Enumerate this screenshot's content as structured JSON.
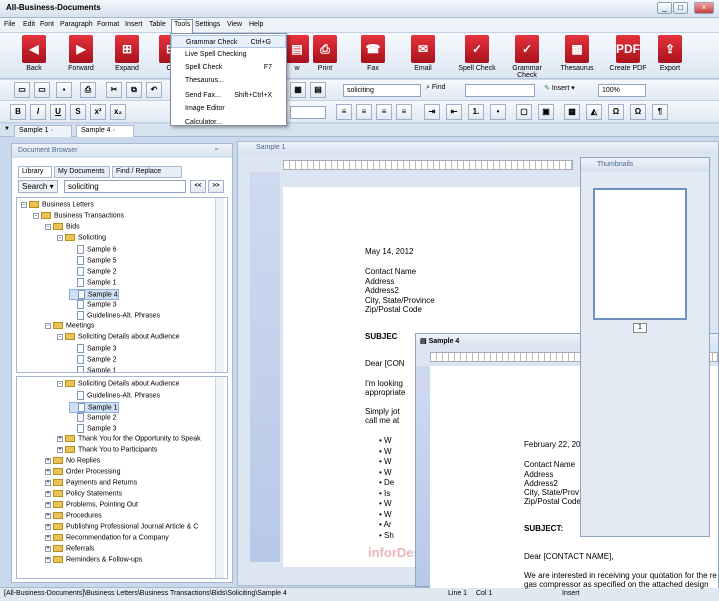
{
  "app": {
    "title": "All-Business-Documents"
  },
  "menu": [
    "File",
    "Edit",
    "Font",
    "Paragraph",
    "Format",
    "Insert",
    "Table",
    "Tools",
    "Settings",
    "View",
    "Help"
  ],
  "ribbon": [
    {
      "label": "Back",
      "icon": "back-arrow-icon",
      "glyph": "◀"
    },
    {
      "label": "Forward",
      "icon": "forward-arrow-icon",
      "glyph": "▶"
    },
    {
      "label": "Expand",
      "icon": "expand-icon",
      "glyph": "⊞"
    },
    {
      "label": "Co",
      "icon": "collapse-icon",
      "glyph": "⊟"
    },
    {
      "label": "w",
      "icon": "preview-icon",
      "glyph": "▤"
    },
    {
      "label": "Print",
      "icon": "print-icon",
      "glyph": "⎙"
    },
    {
      "label": "Fax",
      "icon": "fax-icon",
      "glyph": "☎"
    },
    {
      "label": "Email",
      "icon": "email-icon",
      "glyph": "✉"
    },
    {
      "label": "Spell Check",
      "icon": "spell-check-icon",
      "glyph": "✓"
    },
    {
      "label": "Grammar Check",
      "icon": "grammar-check-icon",
      "glyph": "✓"
    },
    {
      "label": "Thesaurus",
      "icon": "thesaurus-icon",
      "glyph": "▦"
    },
    {
      "label": "Create PDF",
      "icon": "pdf-icon",
      "glyph": "PDF"
    },
    {
      "label": "Export",
      "icon": "export-icon",
      "glyph": "⇪"
    }
  ],
  "tools_menu": [
    {
      "label": "Grammar Check",
      "shortcut": "Ctrl+G"
    },
    {
      "label": "Live Spell Checking",
      "shortcut": ""
    },
    {
      "label": "Spell Check",
      "shortcut": "F7"
    },
    {
      "label": "Thesaurus...",
      "shortcut": ""
    },
    {
      "label": "Send Fax...",
      "shortcut": "Shift+Ctrl+X"
    },
    {
      "label": "Image Editor",
      "shortcut": ""
    },
    {
      "label": "Calculator...",
      "shortcut": ""
    }
  ],
  "toolbar": {
    "search_value": "soliciting",
    "find_label": "Find",
    "insert_label": "Insert",
    "zoom_value": "100%"
  },
  "doc_tabs": [
    "Sample 1",
    "Sample 4"
  ],
  "browser": {
    "title": "Document Browser",
    "tabs": [
      "Library",
      "My Documents",
      "Find / Replace"
    ],
    "search_label": "Search",
    "search_value": "soliciting",
    "prev": "<<",
    "next": ">>",
    "tree_top": [
      {
        "label": "Business Letters",
        "depth": 0,
        "type": "folder",
        "exp": "-"
      },
      {
        "label": "Business Transactions",
        "depth": 1,
        "type": "folder",
        "exp": "-"
      },
      {
        "label": "Bids",
        "depth": 2,
        "type": "folder",
        "exp": "-"
      },
      {
        "label": "Soliciting",
        "depth": 3,
        "type": "folder",
        "exp": "-"
      },
      {
        "label": "Sample 6",
        "depth": 4,
        "type": "doc"
      },
      {
        "label": "Sample 5",
        "depth": 4,
        "type": "doc"
      },
      {
        "label": "Sample 2",
        "depth": 4,
        "type": "doc"
      },
      {
        "label": "Sample 1",
        "depth": 4,
        "type": "doc"
      },
      {
        "label": "Sample 4",
        "depth": 4,
        "type": "doc",
        "sel": true
      },
      {
        "label": "Sample 3",
        "depth": 4,
        "type": "doc"
      },
      {
        "label": "Guidelines-Alt. Phrases",
        "depth": 4,
        "type": "doc"
      },
      {
        "label": "Meetings",
        "depth": 2,
        "type": "folder",
        "exp": "-"
      },
      {
        "label": "Soliciting Details about Audience",
        "depth": 3,
        "type": "folder",
        "exp": "-"
      },
      {
        "label": "Sample 3",
        "depth": 4,
        "type": "doc"
      },
      {
        "label": "Sample 2",
        "depth": 4,
        "type": "doc"
      },
      {
        "label": "Sample 1",
        "depth": 4,
        "type": "doc"
      }
    ],
    "tree_bottom": [
      {
        "label": "Soliciting Details about Audience",
        "depth": 3,
        "type": "folder",
        "exp": "-"
      },
      {
        "label": "Guidelines-Alt. Phrases",
        "depth": 4,
        "type": "doc"
      },
      {
        "label": "Sample 1",
        "depth": 4,
        "type": "doc",
        "sel": true
      },
      {
        "label": "Sample 2",
        "depth": 4,
        "type": "doc"
      },
      {
        "label": "Sample 3",
        "depth": 4,
        "type": "doc"
      },
      {
        "label": "Thank You for the Opportunity to Speak",
        "depth": 3,
        "type": "folder",
        "exp": "+"
      },
      {
        "label": "Thank You to Participants",
        "depth": 3,
        "type": "folder",
        "exp": "+"
      },
      {
        "label": "No Replies",
        "depth": 2,
        "type": "folder",
        "exp": "+"
      },
      {
        "label": "Order Processing",
        "depth": 2,
        "type": "folder",
        "exp": "+"
      },
      {
        "label": "Payments and Returns",
        "depth": 2,
        "type": "folder",
        "exp": "+"
      },
      {
        "label": "Policy Statements",
        "depth": 2,
        "type": "folder",
        "exp": "+"
      },
      {
        "label": "Problems, Pointing Out",
        "depth": 2,
        "type": "folder",
        "exp": "+"
      },
      {
        "label": "Procedures",
        "depth": 2,
        "type": "folder",
        "exp": "+"
      },
      {
        "label": "Publishing Professional Journal Article & C",
        "depth": 2,
        "type": "folder",
        "exp": "+"
      },
      {
        "label": "Recommendation for a Company",
        "depth": 2,
        "type": "folder",
        "exp": "+"
      },
      {
        "label": "Referrals",
        "depth": 2,
        "type": "folder",
        "exp": "+"
      },
      {
        "label": "Reminders & Follow-ups",
        "depth": 2,
        "type": "folder",
        "exp": "+"
      }
    ]
  },
  "sample1": {
    "title": "Sample 1",
    "date": "May 14, 2012",
    "contact": [
      "Contact Name",
      "Address",
      "Address2",
      "City, State/Province",
      "Zip/Postal Code"
    ],
    "subject": "SUBJEC",
    "dear": "Dear [CON",
    "p1": "I'm looking",
    "p1b": "appropriate",
    "p2": "Simply jot",
    "p2b": "call me at",
    "bullets": [
      "W",
      "W",
      "W",
      "W",
      "De",
      "Is",
      "W",
      "W",
      "Ar",
      "Sh"
    ]
  },
  "sample4": {
    "title": "Sample 4",
    "date": "February 22, 20",
    "contact": [
      "Contact Name",
      "Address",
      "Address2",
      "City, State/Prov",
      "Zip/Postal Code"
    ],
    "subject": "SUBJECT:",
    "dear": "Dear [CONTACT NAME],",
    "p1": "We are interested in receiving your quotation for the re",
    "p1b": "gas compressor as specified on the attached design"
  },
  "thumbnails": {
    "title": "Thumbnails",
    "page_no": "1"
  },
  "watermark": "inforDesk",
  "status": {
    "path": "[All-Business-Documents]\\Business Letters\\Business Transactions\\Bids\\Soliciting\\Sample 4",
    "line": "Line 1",
    "col": "Col 1",
    "mode": "Insert"
  }
}
